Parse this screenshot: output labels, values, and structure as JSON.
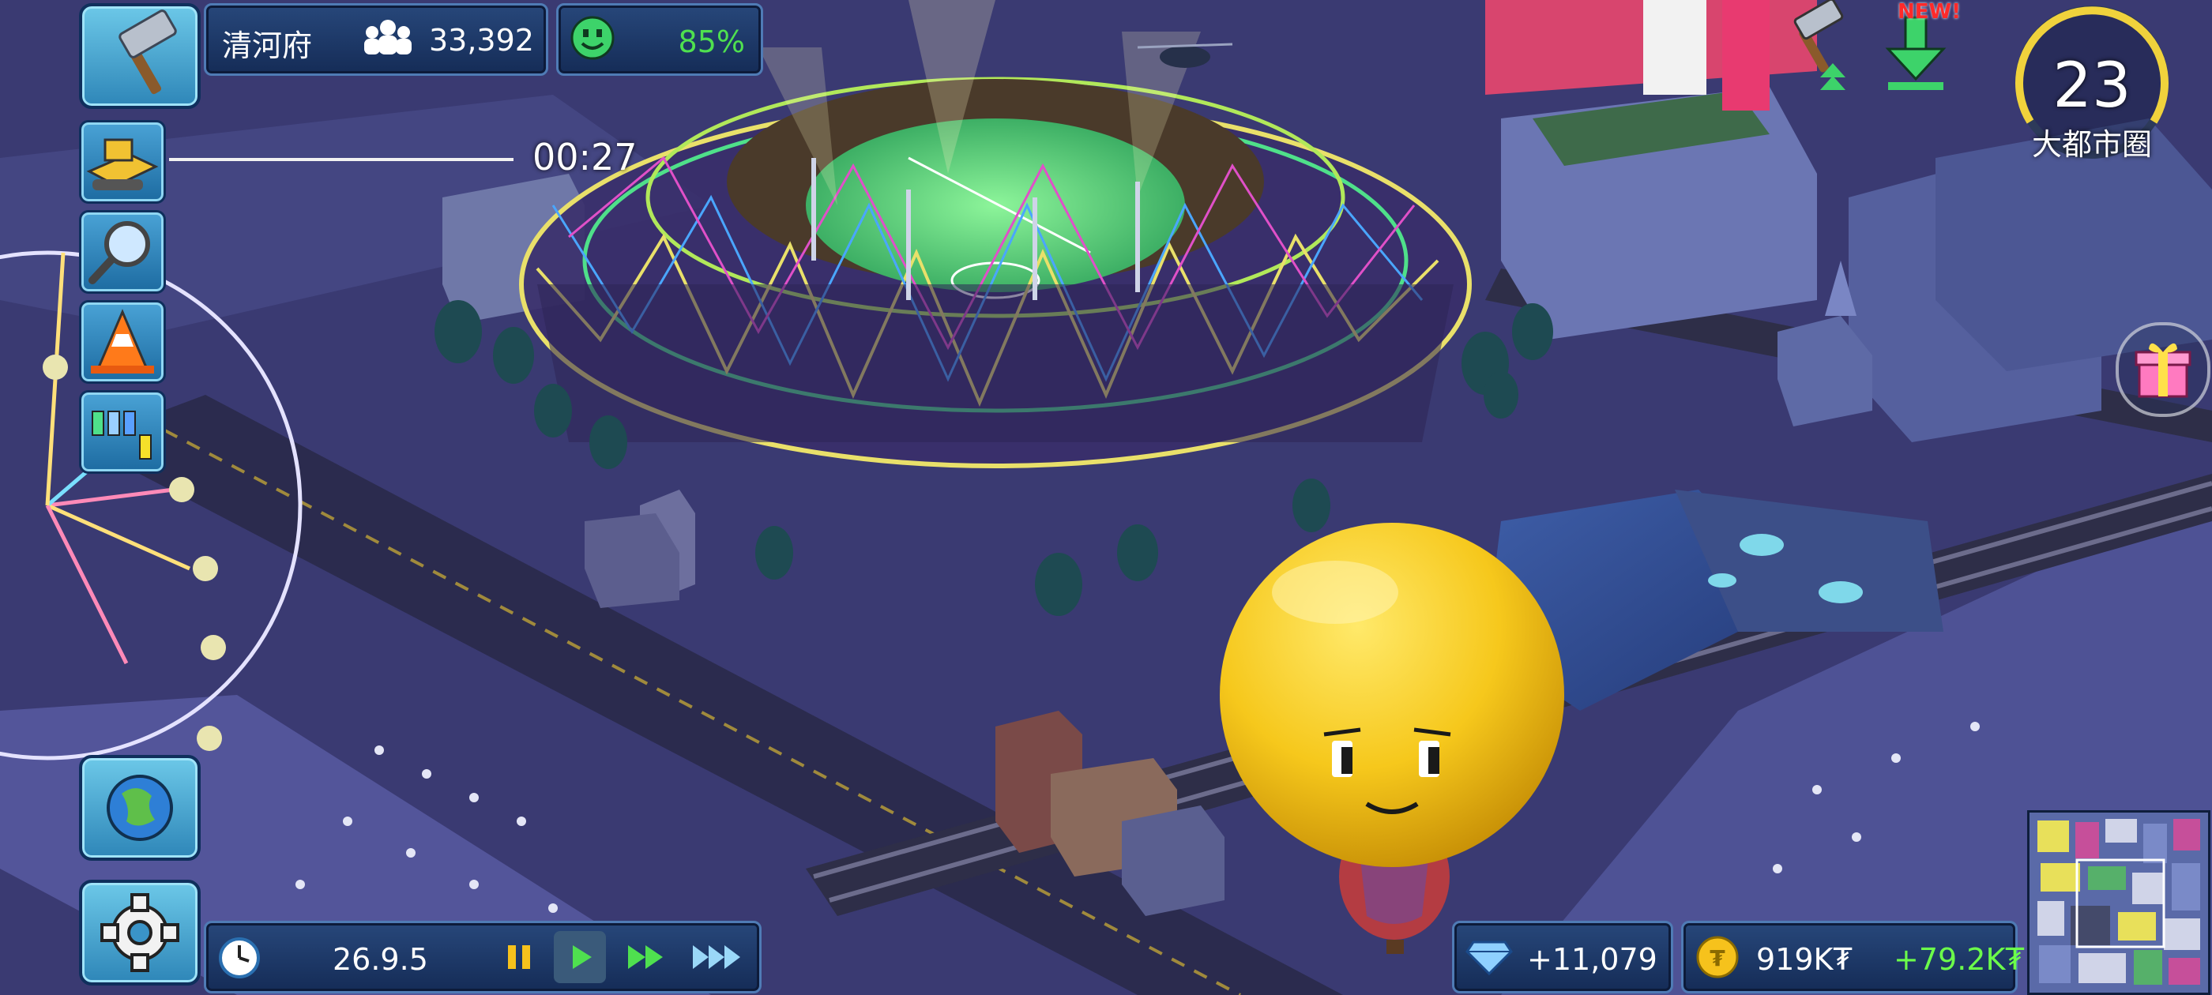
{
  "city": {
    "name": "清河府",
    "population": "33,392",
    "happiness": "85%"
  },
  "event_timer": "00:27",
  "date": "26.9.5",
  "level": {
    "number": "23",
    "title": "大都市圈"
  },
  "new_badge": "NEW!",
  "currency": {
    "diamonds": "+11,079",
    "money": "919K₮",
    "money_income": "+79.2K₮"
  },
  "icons": {
    "build": "hammer-icon",
    "bulldoze": "bulldozer-icon",
    "inspect": "magnifier-icon",
    "roads": "cone-icon",
    "stats": "bar-chart-icon",
    "world": "globe-icon",
    "settings": "gear-icon",
    "population": "people-icon",
    "happiness": "smiley-icon",
    "clock": "clock-icon",
    "pause": "pause-icon",
    "play": "play-icon",
    "fast": "fast-forward-icon",
    "fastest": "fastest-forward-icon",
    "upgrade": "hammer-upgrade-icon",
    "download": "download-arrow-icon",
    "gift": "gift-icon",
    "diamond": "diamond-icon",
    "coin": "coin-icon",
    "minimap": "minimap"
  },
  "colors": {
    "panel": "#1b3766",
    "happiness_green": "#4fe04f",
    "income_green": "#6cff4a",
    "level_ring": "#f0d23c",
    "balloon": "#f6c81c"
  }
}
